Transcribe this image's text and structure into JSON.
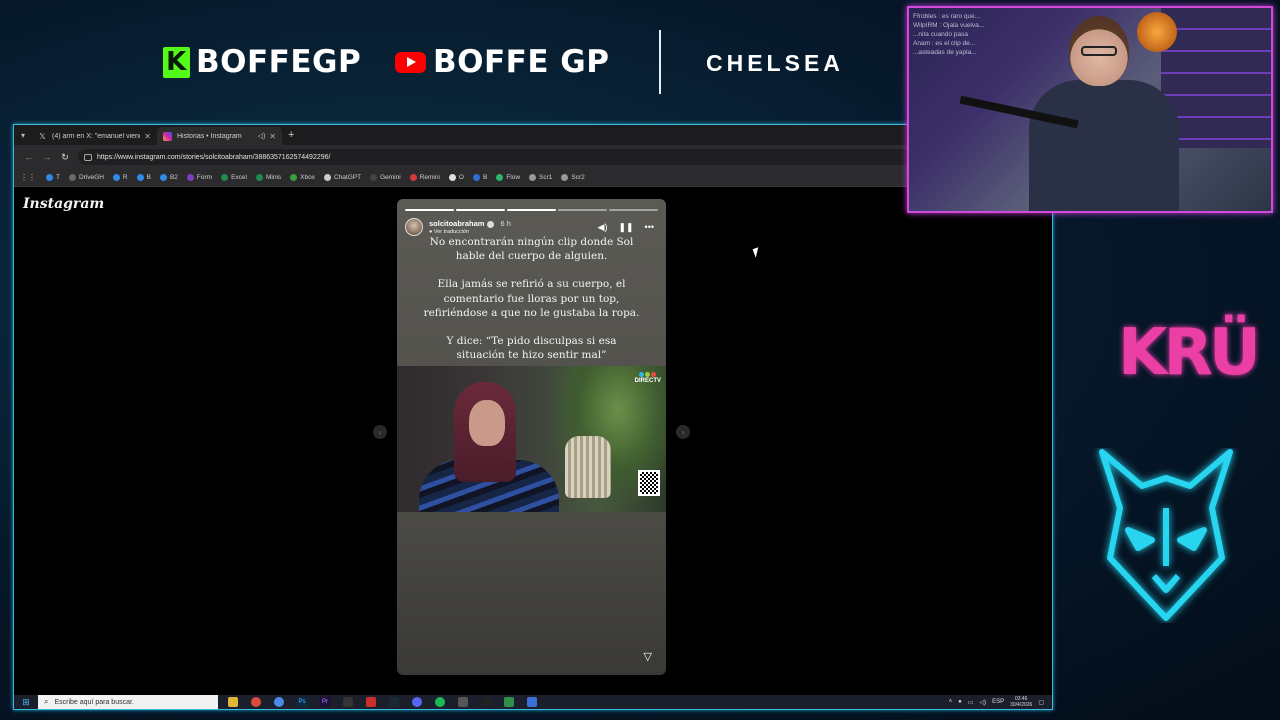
{
  "banner": {
    "kick_logo_letter": "K",
    "kick_name": "BOFFEGP",
    "youtube_name": "BOFFE GP",
    "team_name": "CHELSEA"
  },
  "browser": {
    "tabs": [
      {
        "icon": "x-logo-icon",
        "label": "(4) arm en X: \"emanuel viendo c",
        "active": false
      },
      {
        "icon": "instagram-icon",
        "label": "Historias • Instagram",
        "active": true
      }
    ],
    "url": "https://www.instagram.com/stories/solcitoabraham/3886357162574492296/",
    "bookmarks": [
      {
        "label": "T",
        "color": "#2f8be6"
      },
      {
        "label": "DriveGH",
        "color": "#6a6a6a"
      },
      {
        "label": "R",
        "color": "#2f8be6"
      },
      {
        "label": "B",
        "color": "#2f8be6"
      },
      {
        "label": "B2",
        "color": "#2f8be6"
      },
      {
        "label": "Form",
        "color": "#7b3fc4"
      },
      {
        "label": "Excel",
        "color": "#1f8b4c"
      },
      {
        "label": "Minis",
        "color": "#1f8b4c"
      },
      {
        "label": "Xbox",
        "color": "#3a9e3a"
      },
      {
        "label": "ChatGPT",
        "color": "#cccccc"
      },
      {
        "label": "Gemini",
        "color": "#444444"
      },
      {
        "label": "Remini",
        "color": "#d23a3a"
      },
      {
        "label": "O",
        "color": "#dddddd"
      },
      {
        "label": "B",
        "color": "#2f6fd6"
      },
      {
        "label": "Flow",
        "color": "#2fb56a"
      },
      {
        "label": "Scr1",
        "color": "#999999"
      },
      {
        "label": "Scr2",
        "color": "#999999"
      }
    ]
  },
  "instagram": {
    "logo": "Instagram",
    "story": {
      "username": "solcitoabraham",
      "time": "6 h",
      "translate_label": "Ver traducción",
      "paragraphs": [
        "No encontrarán ningún clip donde Sol hable del cuerpo de alguien.",
        "Ella jamás se refirió a su cuerpo, el comentario fue lloras por un top, refiriéndose a que no le gustaba la ropa.",
        "Y dice: “Te pido disculpas si esa situación te hizo sentir mal”"
      ],
      "channel_label": "DIRECTV",
      "progress_total": 5,
      "progress_done": 3
    }
  },
  "taskbar": {
    "search_placeholder": "Escribe aquí para buscar.",
    "language": "ESP",
    "time": "03:46",
    "date": "30/4/2026"
  },
  "webcam": {
    "chat_lines": [
      "Ffrobles : es raro que...",
      "WilpIRM : Ojala vuelva...",
      "...nita cuando pasa",
      "Anam : es el clip de...",
      "...asteadas de yapla..."
    ]
  },
  "overlay": {
    "kru_text": "KRÜ"
  }
}
